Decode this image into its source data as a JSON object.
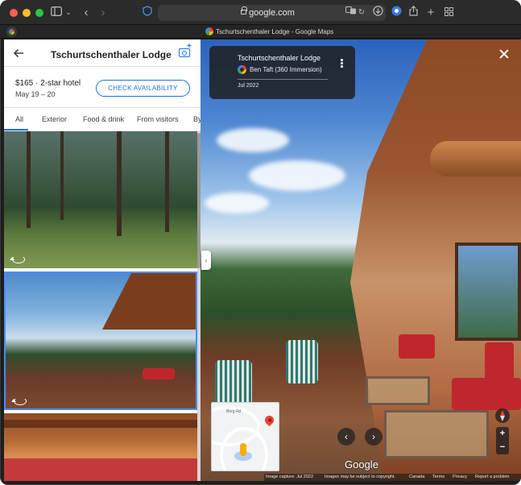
{
  "browser": {
    "address": "google.com",
    "tab_title": "Tschurtschenthaler Lodge - Google Maps"
  },
  "panel": {
    "title": "Tschurtschenthaler Lodge",
    "price": "$165 · 2-star hotel",
    "dates": "May 19 – 20",
    "check_availability": "CHECK AVAILABILITY",
    "tabs": [
      "All",
      "Exterior",
      "Food & drink",
      "From visitors",
      "By"
    ]
  },
  "streetview": {
    "title": "Tschurtschenthaler Lodge",
    "author": "Ben Taft (360 Immersion)",
    "date": "Jul 2022",
    "google": "Google",
    "minimap_road_label": "Berg Rd",
    "footer": {
      "capture": "Image capture: Jul 2022",
      "copyright": "Images may be subject to copyright.",
      "canada": "Canada",
      "terms": "Terms",
      "privacy": "Privacy",
      "report": "Report a problem"
    }
  },
  "colors": {
    "accent": "#1a73e8",
    "pin": "#ea4335",
    "pegman": "#f9ab00"
  },
  "icons": [
    "sidebar-icon",
    "chevron-down-icon",
    "back-arrow-icon",
    "forward-arrow-icon",
    "shield-icon",
    "lock-icon",
    "translate-icon",
    "reload-icon",
    "download-icon",
    "extension-icon",
    "share-icon",
    "new-tab-icon",
    "tab-overview-icon",
    "camera-add-icon",
    "360-icon",
    "more-icon",
    "close-icon",
    "compass-icon",
    "zoom-in-icon",
    "zoom-out-icon"
  ]
}
